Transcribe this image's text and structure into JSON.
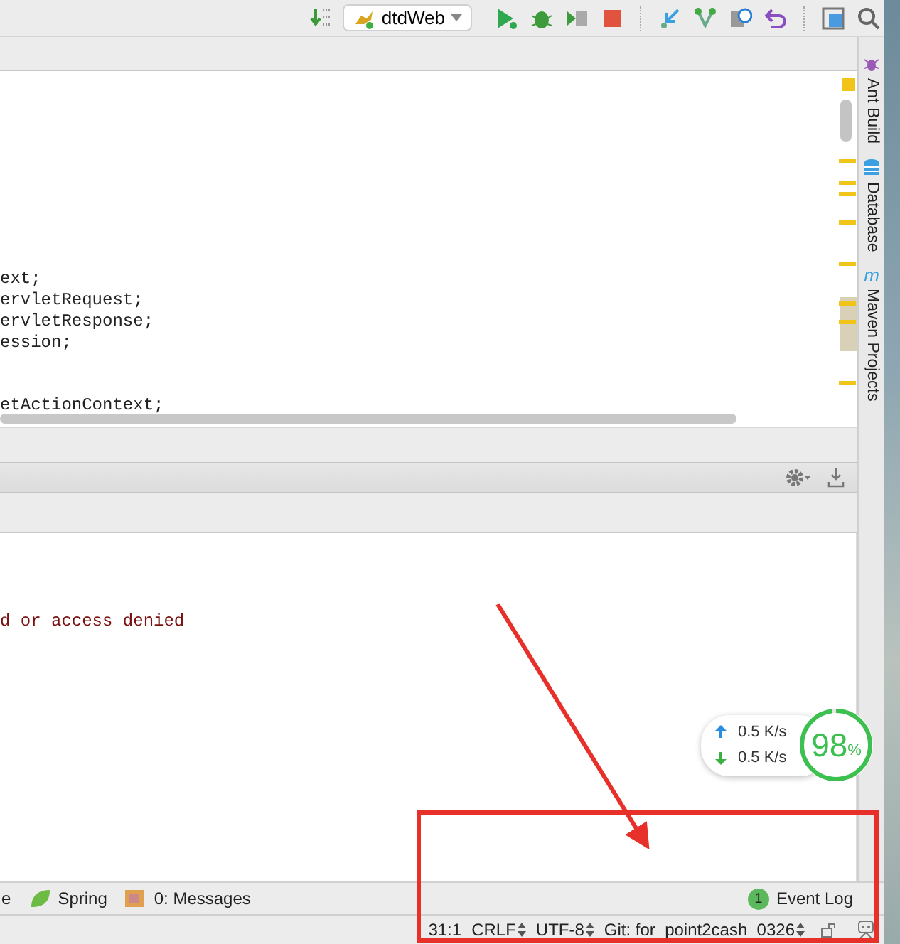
{
  "toolbar": {
    "run_config": "dtdWeb"
  },
  "right_tool_strip": [
    {
      "label": "Ant Build",
      "kind": "ant"
    },
    {
      "label": "Database",
      "kind": "database"
    },
    {
      "label": "Maven Projects",
      "kind": "maven",
      "icon_text": "m"
    }
  ],
  "editor": {
    "code_blocks": [
      [
        "ext;",
        "ervletRequest;",
        "ervletResponse;",
        "ession;"
      ],
      [
        "etActionContext;"
      ]
    ]
  },
  "console": {
    "lines": [
      "d or access denied"
    ]
  },
  "network_monitor": {
    "upload": "0.5 K/s",
    "download": "0.5 K/s",
    "percent": "98",
    "percent_sign": "%",
    "level": 0.98
  },
  "tool_window_bar": [
    {
      "label": "e",
      "kind": "plain"
    },
    {
      "label": "Spring",
      "kind": "spring"
    },
    {
      "label": "0: Messages",
      "kind": "messages"
    }
  ],
  "event_log": {
    "badge": "1",
    "label": "Event Log"
  },
  "status_bar": [
    {
      "label": "31:1",
      "kind": "plain"
    },
    {
      "label": "CRLF",
      "kind": "select"
    },
    {
      "label": "UTF-8",
      "kind": "select"
    },
    {
      "label": "Git: for_point2cash_0326",
      "kind": "select"
    }
  ]
}
